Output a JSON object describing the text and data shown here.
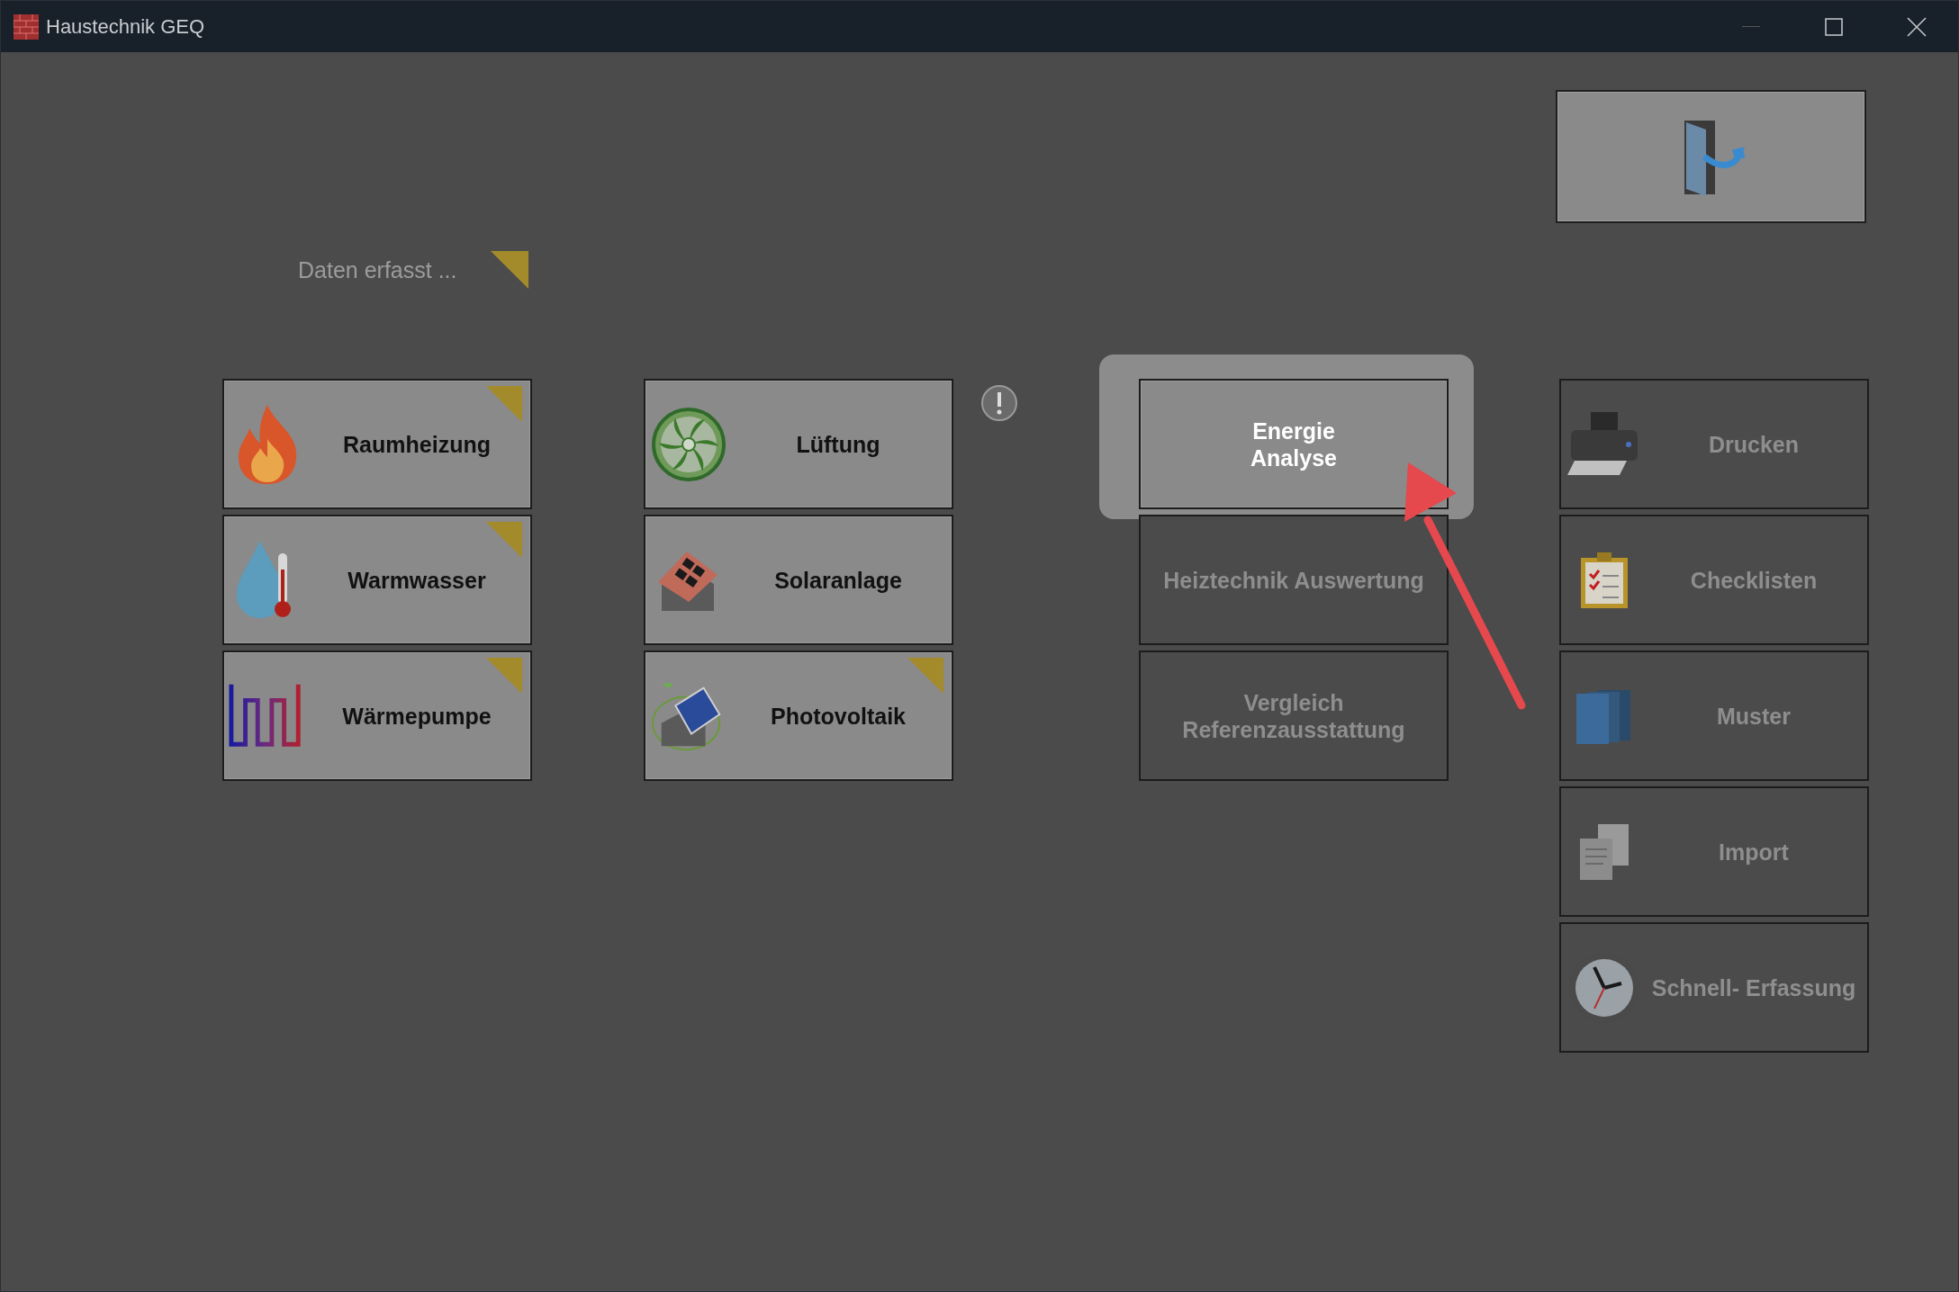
{
  "window": {
    "title": "Haustechnik GEQ"
  },
  "legend": {
    "label": "Daten erfasst ..."
  },
  "columns": [
    {
      "buttons": [
        {
          "label": "Raumheizung",
          "disabled": false,
          "flagged": true
        },
        {
          "label": "Warmwasser",
          "disabled": false,
          "flagged": true
        },
        {
          "label": "Wärmepumpe",
          "disabled": false,
          "flagged": true
        }
      ]
    },
    {
      "buttons": [
        {
          "label": "Lüftung",
          "disabled": false,
          "flagged": false
        },
        {
          "label": "Solaranlage",
          "disabled": false,
          "flagged": false
        },
        {
          "label": "Photovoltaik",
          "disabled": false,
          "flagged": true
        }
      ]
    },
    {
      "buttons": [
        {
          "label": "Energie\nAnalyse",
          "disabled": false,
          "highlighted": true
        },
        {
          "label": "Heiztechnik Auswertung",
          "disabled": true,
          "highlighted": false
        },
        {
          "label": "Vergleich\nReferenzausstattung",
          "disabled": true,
          "highlighted": false
        }
      ]
    },
    {
      "buttons": [
        {
          "label": "Drucken",
          "disabled": true
        },
        {
          "label": "Checklisten",
          "disabled": true
        },
        {
          "label": "Muster",
          "disabled": true
        },
        {
          "label": "Import",
          "disabled": true
        },
        {
          "label": "Schnell- Erfassung",
          "disabled": true
        }
      ]
    }
  ]
}
